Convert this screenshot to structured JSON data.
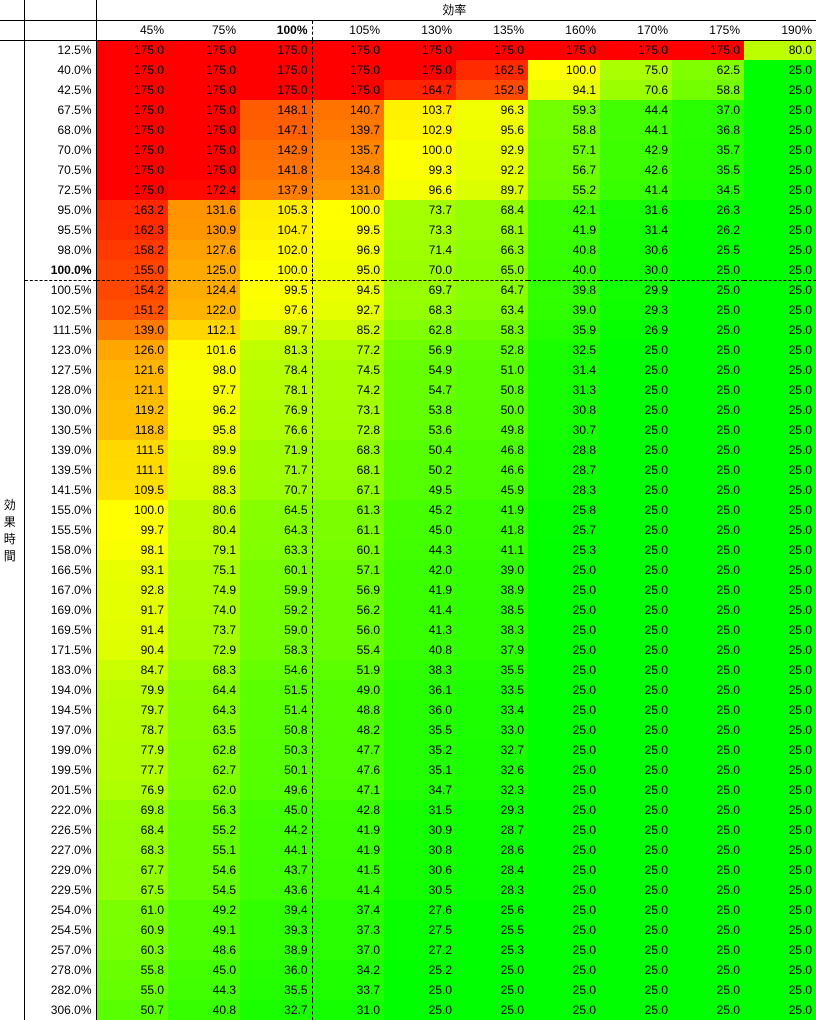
{
  "chart_data": {
    "type": "heatmap",
    "col_title": "効率",
    "row_title": "効果時間",
    "columns": [
      "45%",
      "75%",
      "100%",
      "105%",
      "130%",
      "135%",
      "160%",
      "170%",
      "175%",
      "190%"
    ],
    "bold_col": 2,
    "rows": [
      "12.5%",
      "40.0%",
      "42.5%",
      "67.5%",
      "68.0%",
      "70.0%",
      "70.5%",
      "72.5%",
      "95.0%",
      "95.5%",
      "98.0%",
      "100.0%",
      "100.5%",
      "102.5%",
      "111.5%",
      "123.0%",
      "127.5%",
      "128.0%",
      "130.0%",
      "130.5%",
      "139.0%",
      "139.5%",
      "141.5%",
      "155.0%",
      "155.5%",
      "158.0%",
      "166.5%",
      "167.0%",
      "169.0%",
      "169.5%",
      "171.5%",
      "183.0%",
      "194.0%",
      "194.5%",
      "197.0%",
      "199.0%",
      "199.5%",
      "201.5%",
      "222.0%",
      "226.5%",
      "227.0%",
      "229.0%",
      "229.5%",
      "254.0%",
      "254.5%",
      "257.0%",
      "278.0%",
      "282.0%",
      "306.0%"
    ],
    "bold_row": 11,
    "values": [
      [
        175.0,
        175.0,
        175.0,
        175.0,
        175.0,
        175.0,
        175.0,
        175.0,
        175.0,
        80.0
      ],
      [
        175.0,
        175.0,
        175.0,
        175.0,
        175.0,
        162.5,
        100.0,
        75.0,
        62.5,
        25.0
      ],
      [
        175.0,
        175.0,
        175.0,
        175.0,
        164.7,
        152.9,
        94.1,
        70.6,
        58.8,
        25.0
      ],
      [
        175.0,
        175.0,
        148.1,
        140.7,
        103.7,
        96.3,
        59.3,
        44.4,
        37.0,
        25.0
      ],
      [
        175.0,
        175.0,
        147.1,
        139.7,
        102.9,
        95.6,
        58.8,
        44.1,
        36.8,
        25.0
      ],
      [
        175.0,
        175.0,
        142.9,
        135.7,
        100.0,
        92.9,
        57.1,
        42.9,
        35.7,
        25.0
      ],
      [
        175.0,
        175.0,
        141.8,
        134.8,
        99.3,
        92.2,
        56.7,
        42.6,
        35.5,
        25.0
      ],
      [
        175.0,
        172.4,
        137.9,
        131.0,
        96.6,
        89.7,
        55.2,
        41.4,
        34.5,
        25.0
      ],
      [
        163.2,
        131.6,
        105.3,
        100.0,
        73.7,
        68.4,
        42.1,
        31.6,
        26.3,
        25.0
      ],
      [
        162.3,
        130.9,
        104.7,
        99.5,
        73.3,
        68.1,
        41.9,
        31.4,
        26.2,
        25.0
      ],
      [
        158.2,
        127.6,
        102.0,
        96.9,
        71.4,
        66.3,
        40.8,
        30.6,
        25.5,
        25.0
      ],
      [
        155.0,
        125.0,
        100.0,
        95.0,
        70.0,
        65.0,
        40.0,
        30.0,
        25.0,
        25.0
      ],
      [
        154.2,
        124.4,
        99.5,
        94.5,
        69.7,
        64.7,
        39.8,
        29.9,
        25.0,
        25.0
      ],
      [
        151.2,
        122.0,
        97.6,
        92.7,
        68.3,
        63.4,
        39.0,
        29.3,
        25.0,
        25.0
      ],
      [
        139.0,
        112.1,
        89.7,
        85.2,
        62.8,
        58.3,
        35.9,
        26.9,
        25.0,
        25.0
      ],
      [
        126.0,
        101.6,
        81.3,
        77.2,
        56.9,
        52.8,
        32.5,
        25.0,
        25.0,
        25.0
      ],
      [
        121.6,
        98.0,
        78.4,
        74.5,
        54.9,
        51.0,
        31.4,
        25.0,
        25.0,
        25.0
      ],
      [
        121.1,
        97.7,
        78.1,
        74.2,
        54.7,
        50.8,
        31.3,
        25.0,
        25.0,
        25.0
      ],
      [
        119.2,
        96.2,
        76.9,
        73.1,
        53.8,
        50.0,
        30.8,
        25.0,
        25.0,
        25.0
      ],
      [
        118.8,
        95.8,
        76.6,
        72.8,
        53.6,
        49.8,
        30.7,
        25.0,
        25.0,
        25.0
      ],
      [
        111.5,
        89.9,
        71.9,
        68.3,
        50.4,
        46.8,
        28.8,
        25.0,
        25.0,
        25.0
      ],
      [
        111.1,
        89.6,
        71.7,
        68.1,
        50.2,
        46.6,
        28.7,
        25.0,
        25.0,
        25.0
      ],
      [
        109.5,
        88.3,
        70.7,
        67.1,
        49.5,
        45.9,
        28.3,
        25.0,
        25.0,
        25.0
      ],
      [
        100.0,
        80.6,
        64.5,
        61.3,
        45.2,
        41.9,
        25.8,
        25.0,
        25.0,
        25.0
      ],
      [
        99.7,
        80.4,
        64.3,
        61.1,
        45.0,
        41.8,
        25.7,
        25.0,
        25.0,
        25.0
      ],
      [
        98.1,
        79.1,
        63.3,
        60.1,
        44.3,
        41.1,
        25.3,
        25.0,
        25.0,
        25.0
      ],
      [
        93.1,
        75.1,
        60.1,
        57.1,
        42.0,
        39.0,
        25.0,
        25.0,
        25.0,
        25.0
      ],
      [
        92.8,
        74.9,
        59.9,
        56.9,
        41.9,
        38.9,
        25.0,
        25.0,
        25.0,
        25.0
      ],
      [
        91.7,
        74.0,
        59.2,
        56.2,
        41.4,
        38.5,
        25.0,
        25.0,
        25.0,
        25.0
      ],
      [
        91.4,
        73.7,
        59.0,
        56.0,
        41.3,
        38.3,
        25.0,
        25.0,
        25.0,
        25.0
      ],
      [
        90.4,
        72.9,
        58.3,
        55.4,
        40.8,
        37.9,
        25.0,
        25.0,
        25.0,
        25.0
      ],
      [
        84.7,
        68.3,
        54.6,
        51.9,
        38.3,
        35.5,
        25.0,
        25.0,
        25.0,
        25.0
      ],
      [
        79.9,
        64.4,
        51.5,
        49.0,
        36.1,
        33.5,
        25.0,
        25.0,
        25.0,
        25.0
      ],
      [
        79.7,
        64.3,
        51.4,
        48.8,
        36.0,
        33.4,
        25.0,
        25.0,
        25.0,
        25.0
      ],
      [
        78.7,
        63.5,
        50.8,
        48.2,
        35.5,
        33.0,
        25.0,
        25.0,
        25.0,
        25.0
      ],
      [
        77.9,
        62.8,
        50.3,
        47.7,
        35.2,
        32.7,
        25.0,
        25.0,
        25.0,
        25.0
      ],
      [
        77.7,
        62.7,
        50.1,
        47.6,
        35.1,
        32.6,
        25.0,
        25.0,
        25.0,
        25.0
      ],
      [
        76.9,
        62.0,
        49.6,
        47.1,
        34.7,
        32.3,
        25.0,
        25.0,
        25.0,
        25.0
      ],
      [
        69.8,
        56.3,
        45.0,
        42.8,
        31.5,
        29.3,
        25.0,
        25.0,
        25.0,
        25.0
      ],
      [
        68.4,
        55.2,
        44.2,
        41.9,
        30.9,
        28.7,
        25.0,
        25.0,
        25.0,
        25.0
      ],
      [
        68.3,
        55.1,
        44.1,
        41.9,
        30.8,
        28.6,
        25.0,
        25.0,
        25.0,
        25.0
      ],
      [
        67.7,
        54.6,
        43.7,
        41.5,
        30.6,
        28.4,
        25.0,
        25.0,
        25.0,
        25.0
      ],
      [
        67.5,
        54.5,
        43.6,
        41.4,
        30.5,
        28.3,
        25.0,
        25.0,
        25.0,
        25.0
      ],
      [
        61.0,
        49.2,
        39.4,
        37.4,
        27.6,
        25.6,
        25.0,
        25.0,
        25.0,
        25.0
      ],
      [
        60.9,
        49.1,
        39.3,
        37.3,
        27.5,
        25.5,
        25.0,
        25.0,
        25.0,
        25.0
      ],
      [
        60.3,
        48.6,
        38.9,
        37.0,
        27.2,
        25.3,
        25.0,
        25.0,
        25.0,
        25.0
      ],
      [
        55.8,
        45.0,
        36.0,
        34.2,
        25.2,
        25.0,
        25.0,
        25.0,
        25.0,
        25.0
      ],
      [
        55.0,
        44.3,
        35.5,
        33.7,
        25.0,
        25.0,
        25.0,
        25.0,
        25.0,
        25.0
      ],
      [
        50.7,
        40.8,
        32.7,
        31.0,
        25.0,
        25.0,
        25.0,
        25.0,
        25.0,
        25.0
      ]
    ]
  }
}
